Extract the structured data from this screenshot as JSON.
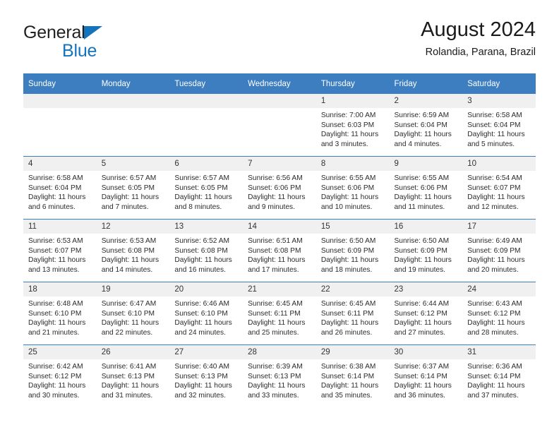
{
  "brand": {
    "name_part1": "General",
    "name_part2": "Blue",
    "triangle_color": "#1473bd"
  },
  "header": {
    "title": "August 2024",
    "subtitle": "Rolandia, Parana, Brazil",
    "header_bg_color": "#3c7ebf",
    "daynum_bg_color": "#f0f0f0"
  },
  "weekday_headers": [
    "Sunday",
    "Monday",
    "Tuesday",
    "Wednesday",
    "Thursday",
    "Friday",
    "Saturday"
  ],
  "weeks": [
    [
      {
        "day": "",
        "sunrise": "",
        "sunset": "",
        "daylight_line1": "",
        "daylight_line2": ""
      },
      {
        "day": "",
        "sunrise": "",
        "sunset": "",
        "daylight_line1": "",
        "daylight_line2": ""
      },
      {
        "day": "",
        "sunrise": "",
        "sunset": "",
        "daylight_line1": "",
        "daylight_line2": ""
      },
      {
        "day": "",
        "sunrise": "",
        "sunset": "",
        "daylight_line1": "",
        "daylight_line2": ""
      },
      {
        "day": "1",
        "sunrise": "Sunrise: 7:00 AM",
        "sunset": "Sunset: 6:03 PM",
        "daylight_line1": "Daylight: 11 hours",
        "daylight_line2": "and 3 minutes."
      },
      {
        "day": "2",
        "sunrise": "Sunrise: 6:59 AM",
        "sunset": "Sunset: 6:04 PM",
        "daylight_line1": "Daylight: 11 hours",
        "daylight_line2": "and 4 minutes."
      },
      {
        "day": "3",
        "sunrise": "Sunrise: 6:58 AM",
        "sunset": "Sunset: 6:04 PM",
        "daylight_line1": "Daylight: 11 hours",
        "daylight_line2": "and 5 minutes."
      }
    ],
    [
      {
        "day": "4",
        "sunrise": "Sunrise: 6:58 AM",
        "sunset": "Sunset: 6:04 PM",
        "daylight_line1": "Daylight: 11 hours",
        "daylight_line2": "and 6 minutes."
      },
      {
        "day": "5",
        "sunrise": "Sunrise: 6:57 AM",
        "sunset": "Sunset: 6:05 PM",
        "daylight_line1": "Daylight: 11 hours",
        "daylight_line2": "and 7 minutes."
      },
      {
        "day": "6",
        "sunrise": "Sunrise: 6:57 AM",
        "sunset": "Sunset: 6:05 PM",
        "daylight_line1": "Daylight: 11 hours",
        "daylight_line2": "and 8 minutes."
      },
      {
        "day": "7",
        "sunrise": "Sunrise: 6:56 AM",
        "sunset": "Sunset: 6:06 PM",
        "daylight_line1": "Daylight: 11 hours",
        "daylight_line2": "and 9 minutes."
      },
      {
        "day": "8",
        "sunrise": "Sunrise: 6:55 AM",
        "sunset": "Sunset: 6:06 PM",
        "daylight_line1": "Daylight: 11 hours",
        "daylight_line2": "and 10 minutes."
      },
      {
        "day": "9",
        "sunrise": "Sunrise: 6:55 AM",
        "sunset": "Sunset: 6:06 PM",
        "daylight_line1": "Daylight: 11 hours",
        "daylight_line2": "and 11 minutes."
      },
      {
        "day": "10",
        "sunrise": "Sunrise: 6:54 AM",
        "sunset": "Sunset: 6:07 PM",
        "daylight_line1": "Daylight: 11 hours",
        "daylight_line2": "and 12 minutes."
      }
    ],
    [
      {
        "day": "11",
        "sunrise": "Sunrise: 6:53 AM",
        "sunset": "Sunset: 6:07 PM",
        "daylight_line1": "Daylight: 11 hours",
        "daylight_line2": "and 13 minutes."
      },
      {
        "day": "12",
        "sunrise": "Sunrise: 6:53 AM",
        "sunset": "Sunset: 6:08 PM",
        "daylight_line1": "Daylight: 11 hours",
        "daylight_line2": "and 14 minutes."
      },
      {
        "day": "13",
        "sunrise": "Sunrise: 6:52 AM",
        "sunset": "Sunset: 6:08 PM",
        "daylight_line1": "Daylight: 11 hours",
        "daylight_line2": "and 16 minutes."
      },
      {
        "day": "14",
        "sunrise": "Sunrise: 6:51 AM",
        "sunset": "Sunset: 6:08 PM",
        "daylight_line1": "Daylight: 11 hours",
        "daylight_line2": "and 17 minutes."
      },
      {
        "day": "15",
        "sunrise": "Sunrise: 6:50 AM",
        "sunset": "Sunset: 6:09 PM",
        "daylight_line1": "Daylight: 11 hours",
        "daylight_line2": "and 18 minutes."
      },
      {
        "day": "16",
        "sunrise": "Sunrise: 6:50 AM",
        "sunset": "Sunset: 6:09 PM",
        "daylight_line1": "Daylight: 11 hours",
        "daylight_line2": "and 19 minutes."
      },
      {
        "day": "17",
        "sunrise": "Sunrise: 6:49 AM",
        "sunset": "Sunset: 6:09 PM",
        "daylight_line1": "Daylight: 11 hours",
        "daylight_line2": "and 20 minutes."
      }
    ],
    [
      {
        "day": "18",
        "sunrise": "Sunrise: 6:48 AM",
        "sunset": "Sunset: 6:10 PM",
        "daylight_line1": "Daylight: 11 hours",
        "daylight_line2": "and 21 minutes."
      },
      {
        "day": "19",
        "sunrise": "Sunrise: 6:47 AM",
        "sunset": "Sunset: 6:10 PM",
        "daylight_line1": "Daylight: 11 hours",
        "daylight_line2": "and 22 minutes."
      },
      {
        "day": "20",
        "sunrise": "Sunrise: 6:46 AM",
        "sunset": "Sunset: 6:10 PM",
        "daylight_line1": "Daylight: 11 hours",
        "daylight_line2": "and 24 minutes."
      },
      {
        "day": "21",
        "sunrise": "Sunrise: 6:45 AM",
        "sunset": "Sunset: 6:11 PM",
        "daylight_line1": "Daylight: 11 hours",
        "daylight_line2": "and 25 minutes."
      },
      {
        "day": "22",
        "sunrise": "Sunrise: 6:45 AM",
        "sunset": "Sunset: 6:11 PM",
        "daylight_line1": "Daylight: 11 hours",
        "daylight_line2": "and 26 minutes."
      },
      {
        "day": "23",
        "sunrise": "Sunrise: 6:44 AM",
        "sunset": "Sunset: 6:12 PM",
        "daylight_line1": "Daylight: 11 hours",
        "daylight_line2": "and 27 minutes."
      },
      {
        "day": "24",
        "sunrise": "Sunrise: 6:43 AM",
        "sunset": "Sunset: 6:12 PM",
        "daylight_line1": "Daylight: 11 hours",
        "daylight_line2": "and 28 minutes."
      }
    ],
    [
      {
        "day": "25",
        "sunrise": "Sunrise: 6:42 AM",
        "sunset": "Sunset: 6:12 PM",
        "daylight_line1": "Daylight: 11 hours",
        "daylight_line2": "and 30 minutes."
      },
      {
        "day": "26",
        "sunrise": "Sunrise: 6:41 AM",
        "sunset": "Sunset: 6:13 PM",
        "daylight_line1": "Daylight: 11 hours",
        "daylight_line2": "and 31 minutes."
      },
      {
        "day": "27",
        "sunrise": "Sunrise: 6:40 AM",
        "sunset": "Sunset: 6:13 PM",
        "daylight_line1": "Daylight: 11 hours",
        "daylight_line2": "and 32 minutes."
      },
      {
        "day": "28",
        "sunrise": "Sunrise: 6:39 AM",
        "sunset": "Sunset: 6:13 PM",
        "daylight_line1": "Daylight: 11 hours",
        "daylight_line2": "and 33 minutes."
      },
      {
        "day": "29",
        "sunrise": "Sunrise: 6:38 AM",
        "sunset": "Sunset: 6:14 PM",
        "daylight_line1": "Daylight: 11 hours",
        "daylight_line2": "and 35 minutes."
      },
      {
        "day": "30",
        "sunrise": "Sunrise: 6:37 AM",
        "sunset": "Sunset: 6:14 PM",
        "daylight_line1": "Daylight: 11 hours",
        "daylight_line2": "and 36 minutes."
      },
      {
        "day": "31",
        "sunrise": "Sunrise: 6:36 AM",
        "sunset": "Sunset: 6:14 PM",
        "daylight_line1": "Daylight: 11 hours",
        "daylight_line2": "and 37 minutes."
      }
    ]
  ]
}
